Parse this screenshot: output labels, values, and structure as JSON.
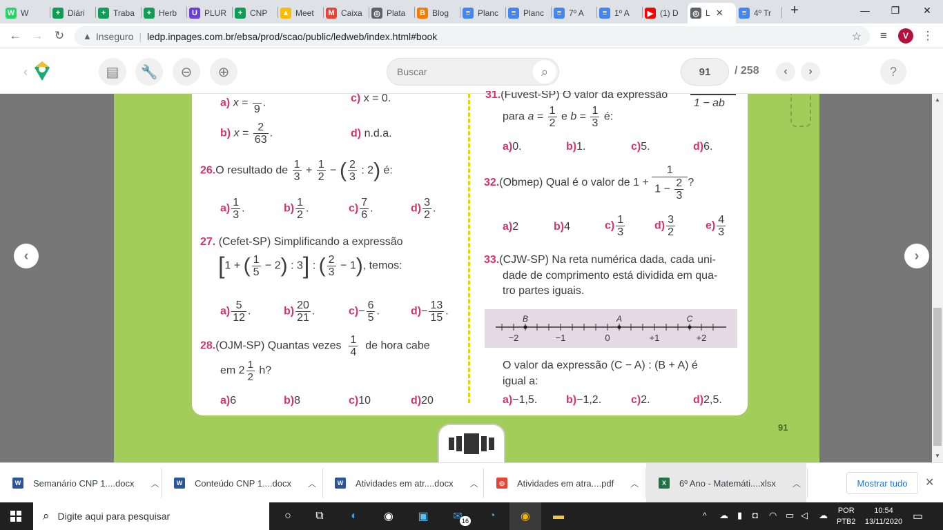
{
  "browser": {
    "tabs": [
      {
        "label": "W",
        "color": "#25d366",
        "glyph": "W"
      },
      {
        "label": "Diári",
        "color": "#0f9d58",
        "glyph": "+"
      },
      {
        "label": "Traba",
        "color": "#0f9d58",
        "glyph": "+"
      },
      {
        "label": "Herb",
        "color": "#0f9d58",
        "glyph": "+"
      },
      {
        "label": "PLUR",
        "color": "#6b3fd4",
        "glyph": "U"
      },
      {
        "label": "CNP",
        "color": "#0f9d58",
        "glyph": "+"
      },
      {
        "label": "Meet",
        "color": "#fbbc04",
        "glyph": "▲"
      },
      {
        "label": "Caixa",
        "color": "#ea4335",
        "glyph": "M"
      },
      {
        "label": "Plata",
        "color": "#5f6368",
        "glyph": "◎"
      },
      {
        "label": "Blog",
        "color": "#f57c00",
        "glyph": "B"
      },
      {
        "label": "Planc",
        "color": "#4285f4",
        "glyph": "≡"
      },
      {
        "label": "Planc",
        "color": "#4285f4",
        "glyph": "≡"
      },
      {
        "label": "7º A",
        "color": "#4285f4",
        "glyph": "≡"
      },
      {
        "label": "1º A",
        "color": "#4285f4",
        "glyph": "≡"
      },
      {
        "label": "(1) D",
        "color": "#ff0000",
        "glyph": "▶"
      },
      {
        "label": "L",
        "color": "#5f6368",
        "glyph": "◎"
      },
      {
        "label": "4º Tr",
        "color": "#4285f4",
        "glyph": "≡"
      }
    ],
    "new_tab": "+",
    "security_label": "Inseguro",
    "url": "ledp.inpages.com.br/ebsa/prod/scao/public/ledweb/index.html#book",
    "profile_initial": "V"
  },
  "app": {
    "search_placeholder": "Buscar",
    "page_current": "91",
    "page_total": "/ 258",
    "help": "?",
    "page_number_footer": "91"
  },
  "content": {
    "q25b_label": "b)",
    "q25b_num": "2",
    "q25b_den": "63",
    "q25a_den": "9",
    "q25a_label": "a)",
    "q25c": "x = 0.",
    "q25c_label": "c)",
    "q25d": "n.d.a.",
    "q25d_label": "d)",
    "q26_num": "26.",
    "q26_text": "O resultado de",
    "q26_tail": "é:",
    "q26_opts": [
      {
        "l": "a)",
        "n": "1",
        "d": "3"
      },
      {
        "l": "b)",
        "n": "1",
        "d": "2"
      },
      {
        "l": "c)",
        "n": "7",
        "d": "6"
      },
      {
        "l": "d)",
        "n": "3",
        "d": "2"
      }
    ],
    "q27_num": "27.",
    "q27_text": "(Cefet-SP) Simplificando a expressão",
    "q27_tail": ", temos:",
    "q27_opts": [
      {
        "l": "a)",
        "s": "",
        "n": "5",
        "d": "12"
      },
      {
        "l": "b)",
        "s": "",
        "n": "20",
        "d": "21"
      },
      {
        "l": "c)",
        "s": "−",
        "n": "6",
        "d": "5"
      },
      {
        "l": "d)",
        "s": "−",
        "n": "13",
        "d": "15"
      }
    ],
    "q28_num": "28.",
    "q28_text1": "(OJM-SP) Quantas vezes",
    "q28_text2": "de hora cabe",
    "q28_text3": "em 2",
    "q28_text4": "h?",
    "q28_opts": [
      {
        "l": "a)",
        "v": "6"
      },
      {
        "l": "b)",
        "v": "8"
      },
      {
        "l": "c)",
        "v": "10"
      },
      {
        "l": "d)",
        "v": "20"
      }
    ],
    "q31_top": "(Fuvest-SP) O valor da expressão",
    "q31_den": "1 − ab",
    "q31_text": "para",
    "q31_opts": [
      {
        "l": "a)",
        "v": "0."
      },
      {
        "l": "b)",
        "v": "1."
      },
      {
        "l": "c)",
        "v": "5."
      },
      {
        "l": "d)",
        "v": "6."
      }
    ],
    "q32_num": "32.",
    "q32_text": "(Obmep) Qual é o valor de 1 +",
    "q32_opts": [
      {
        "l": "a)",
        "v": "2"
      },
      {
        "l": "b)",
        "v": "4"
      }
    ],
    "q32_frac_opts": [
      {
        "l": "c)",
        "n": "1",
        "d": "3"
      },
      {
        "l": "d)",
        "n": "3",
        "d": "2"
      },
      {
        "l": "e)",
        "n": "4",
        "d": "3"
      }
    ],
    "q33_num": "33.",
    "q33_lines": [
      "(CJW-SP) Na reta numérica dada, cada uni-",
      "dade de comprimento está dividida em qua-",
      "tro partes iguais."
    ],
    "numline_labels": [
      "B",
      "A",
      "C"
    ],
    "numline_ticks": [
      "−2",
      "−1",
      "0",
      "+1",
      "+2"
    ],
    "q33_expr1": "O valor da expressão (C − A) : (B + A) é",
    "q33_expr2": "igual a:",
    "q33_opts": [
      {
        "l": "a)",
        "v": "−1,5."
      },
      {
        "l": "b)",
        "v": "−1,2."
      },
      {
        "l": "c)",
        "v": "2."
      },
      {
        "l": "d)",
        "v": "2,5."
      }
    ]
  },
  "downloads": {
    "items": [
      {
        "label": "Semanário CNP 1....docx",
        "color": "#2b579a",
        "glyph": "W"
      },
      {
        "label": "Conteúdo CNP 1....docx",
        "color": "#2b579a",
        "glyph": "W"
      },
      {
        "label": "Atividades em atr....docx",
        "color": "#2b579a",
        "glyph": "W"
      },
      {
        "label": "Atividades em atra....pdf",
        "color": "#ea4335",
        "glyph": "◎"
      },
      {
        "label": "6º Ano - Matemáti....xlsx",
        "color": "#217346",
        "glyph": "X"
      }
    ],
    "show_all": "Mostrar tudo"
  },
  "taskbar": {
    "search_placeholder": "Digite aqui para pesquisar",
    "lang1": "POR",
    "lang2": "PTB2",
    "time": "10:54",
    "date": "13/11/2020",
    "mail_badge": "16"
  }
}
